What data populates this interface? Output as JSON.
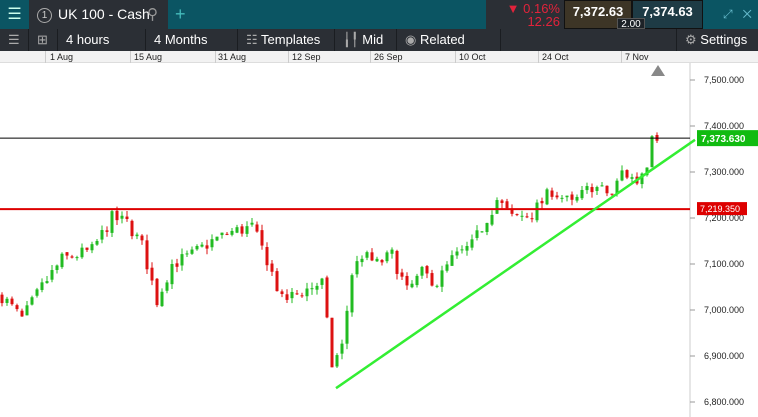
{
  "header": {
    "menu_icon": "hamburger-icon",
    "instrument_number": "1",
    "instrument": "UK 100 - Cash",
    "change_pct": "0.16%",
    "change_abs": "12.26",
    "sell": "7,372.63",
    "buy": "7,374.63",
    "spread": "2.00"
  },
  "toolbar": {
    "interval": "4 hours",
    "range": "4 Months",
    "templates": "Templates",
    "price_type": "Mid",
    "related": "Related",
    "settings": "Settings"
  },
  "colors": {
    "up": "#22bb22",
    "down": "#dd1111",
    "trend": "#33ee33",
    "current_line": "#000000",
    "level_line": "#dd0000"
  },
  "chart_data": {
    "type": "candlestick",
    "x_ticks": [
      "1 Aug",
      "15 Aug",
      "31 Aug",
      "12 Sep",
      "26 Sep",
      "10 Oct",
      "24 Oct",
      "7 Nov"
    ],
    "y_ticks": [
      "7,500.000",
      "7,400.000",
      "7,300.000",
      "7,200.000",
      "7,100.000",
      "7,000.000",
      "6,900.000",
      "6,800.000"
    ],
    "y_values": [
      7500,
      7400,
      7300,
      7200,
      7100,
      7000,
      6900,
      6800
    ],
    "ylim": [
      6800,
      7500
    ],
    "current_price": 7373.63,
    "current_label": "7,373.630",
    "level_price": 7219.35,
    "level_label": "7,219.350",
    "trendline": {
      "from_price": 6830,
      "to_price": 7370
    },
    "approx_close_path": [
      [
        0,
        7030
      ],
      [
        4,
        6980
      ],
      [
        8,
        7050
      ],
      [
        12,
        7110
      ],
      [
        18,
        7130
      ],
      [
        22,
        7200
      ],
      [
        25,
        7190
      ],
      [
        28,
        7140
      ],
      [
        31,
        7020
      ],
      [
        34,
        7100
      ],
      [
        38,
        7120
      ],
      [
        42,
        7150
      ],
      [
        46,
        7170
      ],
      [
        50,
        7180
      ],
      [
        53,
        7110
      ],
      [
        56,
        7020
      ],
      [
        60,
        7040
      ],
      [
        64,
        7060
      ],
      [
        66,
        6880
      ],
      [
        68,
        6920
      ],
      [
        70,
        7080
      ],
      [
        72,
        7120
      ],
      [
        75,
        7100
      ],
      [
        78,
        7120
      ],
      [
        81,
        7040
      ],
      [
        84,
        7080
      ],
      [
        87,
        7060
      ],
      [
        90,
        7110
      ],
      [
        94,
        7140
      ],
      [
        97,
        7200
      ],
      [
        99,
        7240
      ],
      [
        102,
        7200
      ],
      [
        106,
        7210
      ],
      [
        110,
        7260
      ],
      [
        114,
        7230
      ],
      [
        118,
        7270
      ],
      [
        122,
        7250
      ],
      [
        124,
        7300
      ],
      [
        127,
        7280
      ],
      [
        129,
        7320
      ],
      [
        130,
        7390
      ],
      [
        131,
        7380
      ]
    ]
  }
}
